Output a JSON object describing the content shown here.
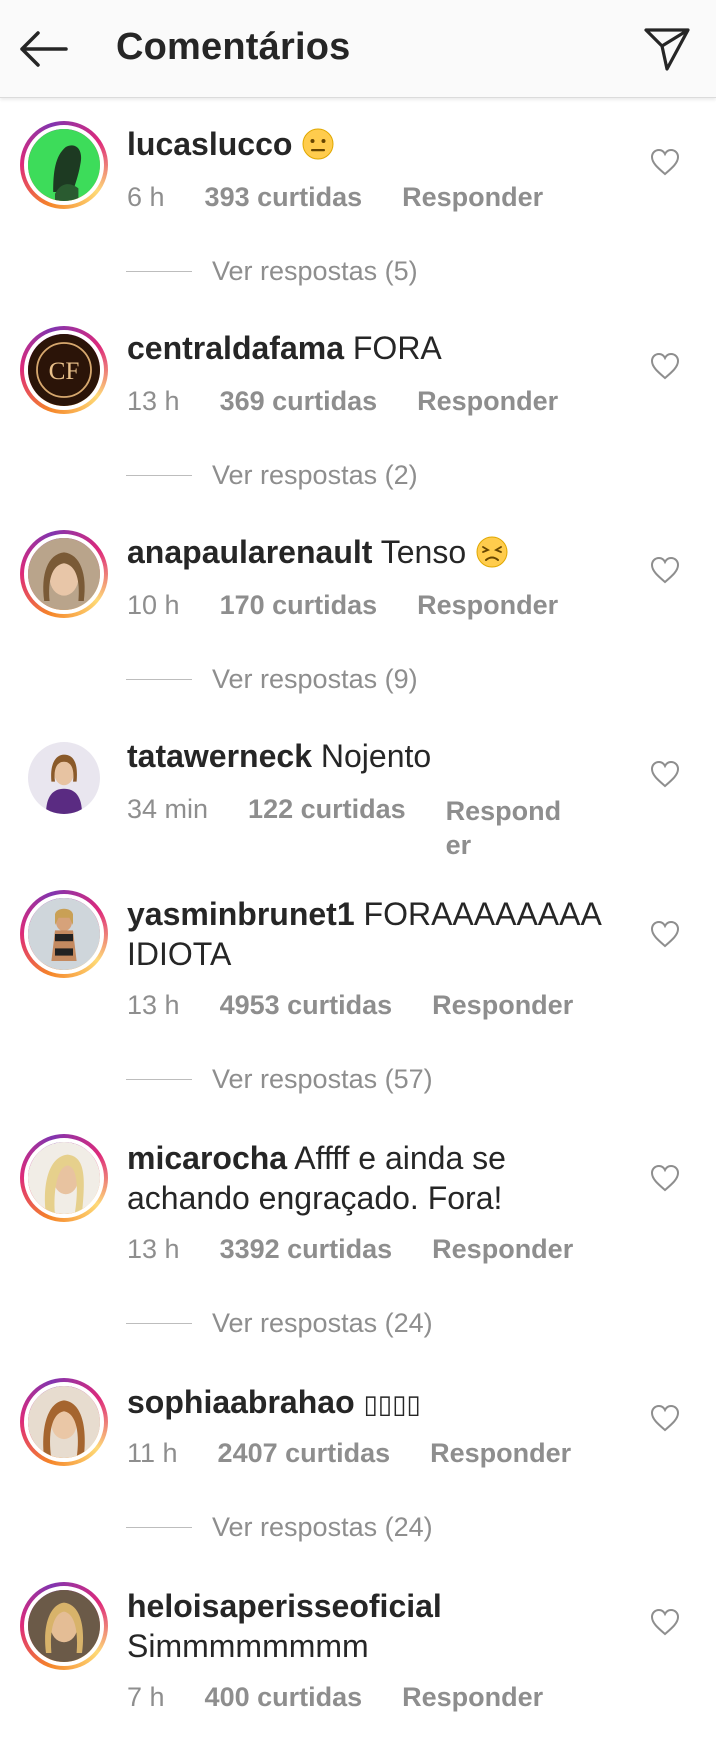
{
  "header": {
    "title": "Comentários",
    "back_icon": "arrow-left-icon",
    "send_icon": "paper-plane-icon"
  },
  "comments": [
    {
      "username": "lucaslucco",
      "text": "",
      "emoji": "neutral-face",
      "time": "6 h",
      "likes": "393 curtidas",
      "reply": "Responder",
      "view_replies": "Ver respostas (5)"
    },
    {
      "username": "centraldafama",
      "text": "FORA",
      "time": "13 h",
      "likes": "369 curtidas",
      "reply": "Responder",
      "view_replies": "Ver respostas (2)"
    },
    {
      "username": "anapaularenault",
      "text": "Tenso",
      "emoji": "persevering-face",
      "time": "10 h",
      "likes": "170 curtidas",
      "reply": "Responder",
      "view_replies": "Ver respostas (9)"
    },
    {
      "username": "tatawerneck",
      "text": "Nojento",
      "time": "34 min",
      "likes": "122 curtidas",
      "reply": "Respond\ner"
    },
    {
      "username": "yasminbrunet1",
      "text": "FORAAAAAAAA IDIOTA",
      "time": "13 h",
      "likes": "4953 curtidas",
      "reply": "Responder",
      "view_replies": "Ver respostas (57)"
    },
    {
      "username": "micarocha",
      "text": "Affff e ainda se achando engraçado. Fora!",
      "time": "13 h",
      "likes": "3392 curtidas",
      "reply": "Responder",
      "view_replies": "Ver respostas (24)"
    },
    {
      "username": "sophiaabrahao",
      "text": "▯▯▯▯",
      "time": "11 h",
      "likes": "2407 curtidas",
      "reply": "Responder",
      "view_replies": "Ver respostas (24)"
    },
    {
      "username": "heloisaperisseoficial",
      "text": "Simmmmmmmm",
      "time": "7 h",
      "likes": "400 curtidas",
      "reply": "Responder"
    }
  ],
  "colors": {
    "text": "#262626",
    "secondary": "#8e8e8e",
    "header_bg": "#fafafa"
  }
}
